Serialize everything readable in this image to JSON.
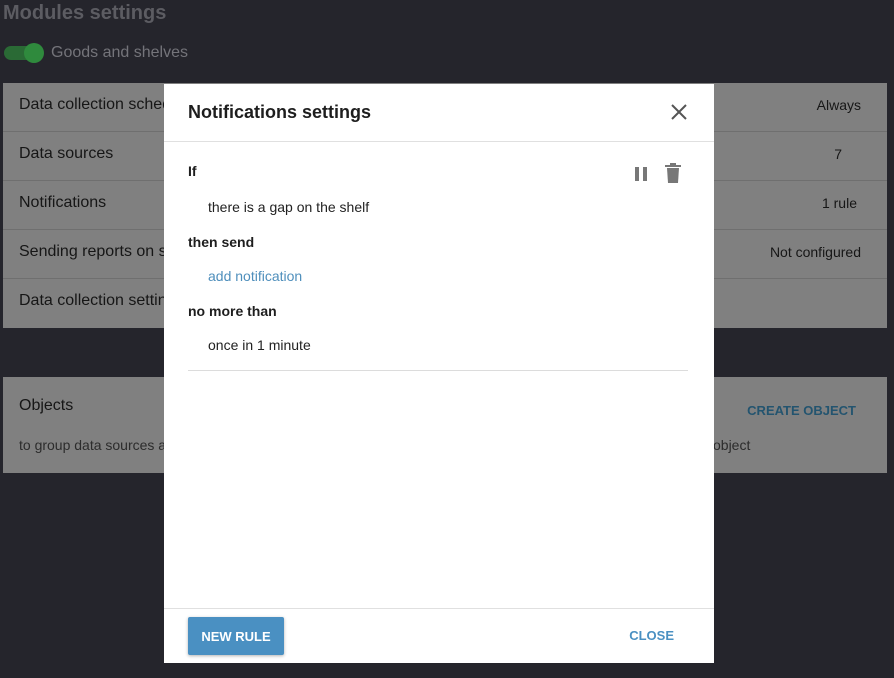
{
  "page": {
    "title": "Modules settings"
  },
  "module_toggle": {
    "label": "Goods and shelves",
    "enabled": true,
    "color": "#2f8a3d"
  },
  "settings_rows": [
    {
      "label": "Data collection schedule",
      "value": "Always"
    },
    {
      "label": "Data sources",
      "value": "7"
    },
    {
      "label": "Notifications",
      "value": "1 rule"
    },
    {
      "label": "Sending reports on schedule",
      "value": "Not configured"
    },
    {
      "label": "Data collection settings",
      "value": ""
    }
  ],
  "objects": {
    "title": "Objects",
    "create_label": "CREATE OBJECT",
    "desc_left": "to group data sources and",
    "desc_right": "object"
  },
  "modal": {
    "title": "Notifications settings",
    "close_icon": "close-icon",
    "rule": {
      "if_label": "If",
      "condition": "there is a gap on the shelf",
      "then_label": "then send",
      "add_link": "add notification",
      "limit_label": "no more than",
      "frequency": "once in 1 minute",
      "pause_icon": "pause-icon",
      "delete_icon": "trash-icon"
    },
    "new_rule_label": "NEW RULE",
    "close_label": "CLOSE",
    "accent_color": "#4a90c2"
  }
}
